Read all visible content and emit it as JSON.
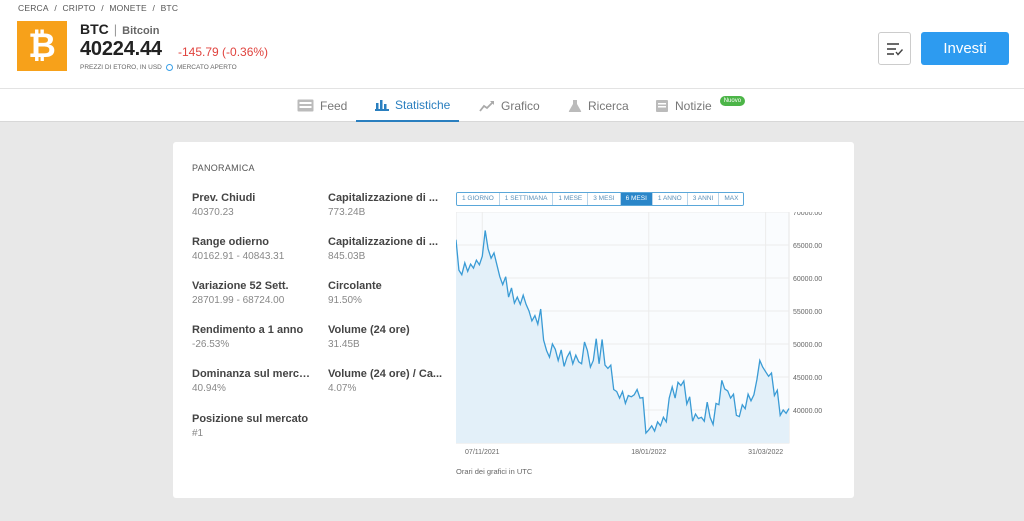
{
  "breadcrumb": [
    "CERCA",
    "/",
    "CRIPTO",
    "/",
    "MONETE",
    "/",
    "BTC"
  ],
  "asset": {
    "ticker": "BTC",
    "separator": "|",
    "name": "Bitcoin",
    "price": "40224.44",
    "change": "-145.79 (-0.36%)",
    "prices_note": "PREZZI DI ETORO, IN USD",
    "market_status": "MERCATO APERTO",
    "logo_symbol": "₿",
    "colors": {
      "logo": "#f7a11a",
      "negative": "#e0433e",
      "accent": "#2d9bf0"
    }
  },
  "header": {
    "invest_label": "Investi",
    "watchlist_icon": "watchlist-icon"
  },
  "tabs": [
    {
      "label": "Feed",
      "icon": "feed-icon"
    },
    {
      "label": "Statistiche",
      "icon": "bar-chart-icon",
      "active": true
    },
    {
      "label": "Grafico",
      "icon": "line-chart-icon"
    },
    {
      "label": "Ricerca",
      "icon": "flask-icon"
    },
    {
      "label": "Notizie",
      "icon": "news-icon",
      "badge": "Nuovo"
    }
  ],
  "panel": {
    "title": "PANORAMICA",
    "stats_left": [
      {
        "label": "Prev. Chiudi",
        "value": "40370.23"
      },
      {
        "label": "Range odierno",
        "value": "40162.91 - 40843.31"
      },
      {
        "label": "Variazione 52 Sett.",
        "value": "28701.99 - 68724.00"
      },
      {
        "label": "Rendimento a 1 anno",
        "value": "-26.53%"
      },
      {
        "label": "Dominanza sul mercato",
        "value": "40.94%"
      },
      {
        "label": "Posizione sul mercato",
        "value": "#1"
      }
    ],
    "stats_right": [
      {
        "label": "Capitalizzazione di ...",
        "value": "773.24B"
      },
      {
        "label": "Capitalizzazione di ...",
        "value": "845.03B"
      },
      {
        "label": "Circolante",
        "value": "91.50%"
      },
      {
        "label": "Volume (24 ore)",
        "value": "31.45B"
      },
      {
        "label": "Volume (24 ore) / Ca...",
        "value": "4.07%"
      }
    ],
    "ranges": [
      "1 GIORNO",
      "1 SETTIMANA",
      "1 MESE",
      "3 MESI",
      "6 MESI",
      "1 ANNO",
      "3 ANNI",
      "MAX"
    ],
    "active_range": "6 MESI",
    "timezone_note": "Orari dei grafici in UTC"
  },
  "chart_data": {
    "type": "area",
    "y_ticks": [
      "70000.00",
      "65000.00",
      "60000.00",
      "55000.00",
      "50000.00",
      "45000.00",
      "40000.00"
    ],
    "x_ticks": [
      "07/11/2021",
      "18/01/2022",
      "31/03/2022"
    ],
    "ylim": [
      35000,
      70000
    ],
    "grid": true,
    "series": [
      {
        "values": [
          65800,
          61200,
          60500,
          62300,
          61000,
          62100,
          61500,
          62700,
          62000,
          63300,
          67200,
          64400,
          63000,
          63800,
          62000,
          60200,
          59000,
          60200,
          57100,
          58500,
          56200,
          57100,
          56000,
          57400,
          56000,
          55000,
          53500,
          54300,
          53000,
          55300,
          50600,
          49000,
          48000,
          50000,
          49200,
          47500,
          49100,
          46600,
          48000,
          48800,
          47000,
          48300,
          47300,
          47000,
          50300,
          49000,
          46500,
          47500,
          50800,
          47000,
          50700,
          46800,
          46300,
          46800,
          43100,
          42800,
          41800,
          42800,
          41000,
          42200,
          42000,
          42300,
          43100,
          41800,
          41900,
          36500,
          37000,
          37600,
          36800,
          38200,
          37600,
          38900,
          38200,
          41800,
          43500,
          41800,
          44200,
          43700,
          44400,
          40900,
          42000,
          38300,
          39400,
          38700,
          38900,
          38300,
          41200,
          38900,
          37800,
          41000,
          40800,
          44500,
          43200,
          42900,
          41800,
          42400,
          39200,
          39000,
          40800,
          40200,
          42400,
          41400,
          42300,
          44600,
          47500,
          46500,
          45800,
          45100,
          45600,
          42200,
          43000,
          39200,
          40000,
          39500,
          40224
        ]
      }
    ]
  }
}
